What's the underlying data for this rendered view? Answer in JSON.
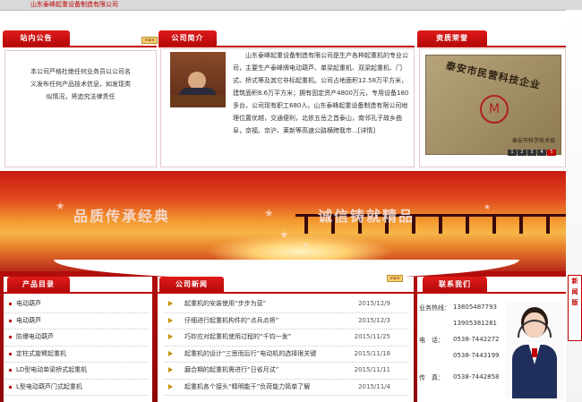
{
  "header": {
    "company_name": "山东泰峰起重设备制造有限公司"
  },
  "notice": {
    "title": "站内公告",
    "more_label": "more",
    "text": "本公司严格杜绝任何业务员以公司名义发布任何产品技术信息，如发现类似情况，将追究法律责任"
  },
  "about": {
    "title": "公司简介",
    "text": "山东泰峰起重设备制造有限公司是生产各种起重机的专业公司，主要生产泰峰牌电动葫芦、单梁起重机、双梁起重机、门式、桥式等及其它非标起重机。公司占地面积12.58万平方米，建筑面积8.6万平方米；拥有固定资产4800万元，专用设备180多台，公司现有职工680人。山东泰峰起重设备制造有限公司地理位置优越，交通便利，北依五岳之首泰山，南邻孔子故乡曲阜，京福、京沪、莱新等高速公路横跨我市...[详情]"
  },
  "honor": {
    "title": "资质荣誉",
    "plaque_text": "泰安市民营科技企业",
    "plaque_sub": "泰安市科学技术局",
    "pages": [
      "1",
      "2",
      "3",
      "4",
      "5"
    ]
  },
  "banner": {
    "slogan_left": "品质传承经典",
    "slogan_right": "诚信铸就精品"
  },
  "products": {
    "title": "产品目录",
    "items": [
      "电动葫芦",
      "电动葫芦",
      "防爆电动葫芦",
      "定柱式旋臂起重机",
      "LD型电动单梁桥式起重机",
      "L型电动葫芦门式起重机"
    ]
  },
  "news": {
    "title": "公司新闻",
    "more_label": "more",
    "items": [
      {
        "title": "起重机的安装使用“步步为营”",
        "date": "2015/12/9"
      },
      {
        "title": "仔细进行起重机构件的“点兵点将”",
        "date": "2015/12/3"
      },
      {
        "title": "巧妙应对起重机使用过程的“千钧一发”",
        "date": "2015/11/25"
      },
      {
        "title": "起重机的设计“三思而后行”电动机的选择很关键",
        "date": "2015/11/18"
      },
      {
        "title": "磨合期的起重机需进行“日省月试”",
        "date": "2015/11/11"
      },
      {
        "title": "起重机各个接头“精明能干”负荷能力简单了解",
        "date": "2015/11/4"
      }
    ]
  },
  "contact": {
    "title": "联系我们",
    "hotline_label": "业务热线：",
    "hotline_1": "13805487793",
    "hotline_2": "13905381281",
    "phone_label": "电　话：",
    "phone_1": "0538-7442272",
    "phone_2": "0538-7443199",
    "fax_label": "传　真：",
    "fax": "0538-7442858"
  },
  "side_tab": {
    "label": "新\n闻\n版"
  },
  "colors": {
    "brand_red": "#c00000",
    "banner_orange": "#f39a2e"
  }
}
